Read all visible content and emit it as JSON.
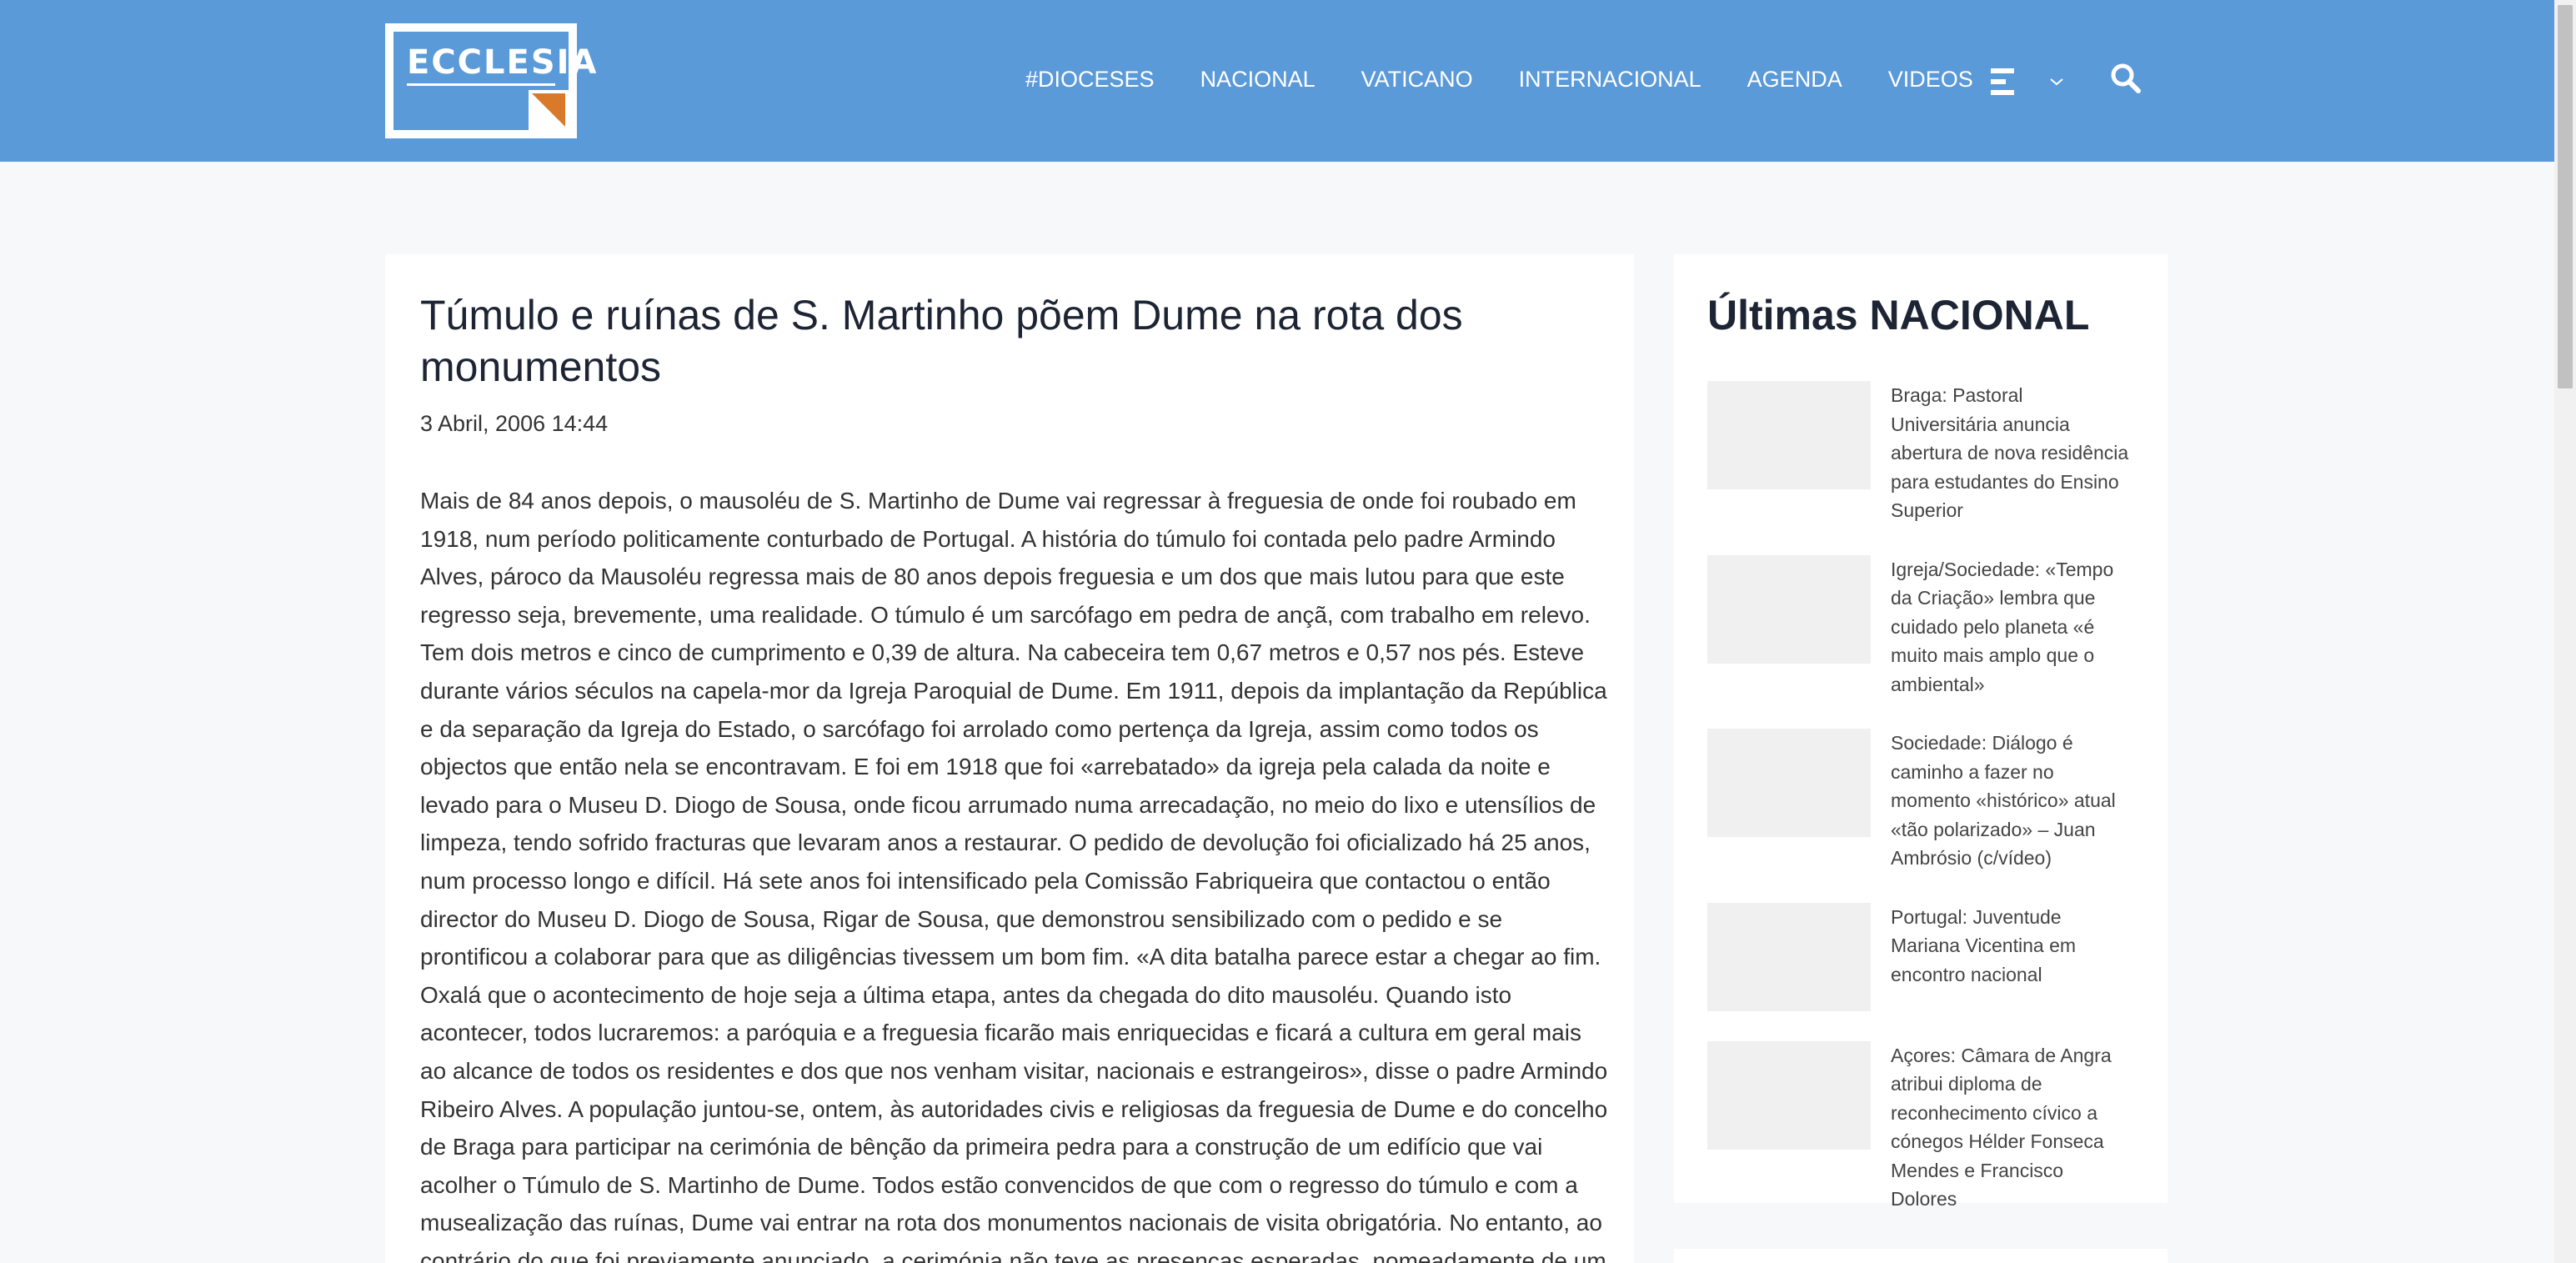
{
  "header": {
    "logo_text": "ECCLESIA",
    "nav": [
      "#DIOCESES",
      "NACIONAL",
      "VATICANO",
      "INTERNACIONAL",
      "AGENDA",
      "VIDEOS"
    ]
  },
  "article": {
    "title": "Túmulo e ruínas de S. Martinho põem Dume na rota dos monumentos",
    "date": "3 Abril, 2006 14:44",
    "body": "Mais de 84 anos depois, o mausoléu de S. Martinho de Dume vai regressar à freguesia de onde foi roubado em 1918, num período politicamente conturbado de Portugal. A história do túmulo foi contada pelo padre Armindo Alves, pároco da Mausoléu regressa mais de 80 anos depois freguesia e um dos que mais lutou para que este regresso seja, brevemente, uma realidade. O túmulo é um sarcófago em pedra de ançã, com trabalho em relevo. Tem dois metros e cinco de cumprimento e 0,39 de altura. Na cabeceira tem 0,67 metros e 0,57 nos pés. Esteve durante vários séculos na capela-mor da Igreja Paroquial de Dume. Em 1911, depois da implantação da República e da separação da Igreja do Estado, o sarcófago foi arrolado como pertença da Igreja, assim como todos os objectos que então nela se encontravam. E foi em 1918 que foi «arrebatado» da igreja pela calada da noite e levado para o Museu D. Diogo de Sousa, onde ficou arrumado numa arrecadação, no meio do lixo e utensílios de limpeza, tendo sofrido fracturas que levaram anos a restaurar. O pedido de devolução foi oficializado há 25 anos, num processo longo e difícil. Há sete anos foi intensificado pela Comissão Fabriqueira que contactou o então director do Museu D. Diogo de Sousa, Rigar de Sousa, que demonstrou sensibilizado com o pedido e se prontificou a colaborar para que as diligências tivessem um bom fim. «A dita batalha parece estar a chegar ao fim. Oxalá que o acontecimento de hoje seja a última etapa, antes da chegada do dito mausoléu. Quando isto acontecer, todos lucraremos: a paróquia e a freguesia ficarão mais enriquecidas e ficará a cultura em geral mais ao alcance de todos os residentes e dos que nos venham visitar, nacionais e estrangeiros», disse o padre Armindo Ribeiro Alves. A população juntou-se, ontem, às autoridades civis e religiosas da freguesia de Dume e do concelho de Braga para participar na cerimónia de bênção da primeira pedra para a construção de um edifício que vai acolher o Túmulo de S. Martinho de Dume. Todos estão convencidos de que com o regresso do túmulo e com a musealização das ruínas, Dume vai entrar na rota dos monumentos nacionais de visita obrigatória. No entanto, ao contrário do que foi previamente anunciado, a cerimónia não teve as presenças esperadas, nomeadamente de um representante do IPAAR, de Luís Fontes, da"
  },
  "sidebar": {
    "title": "Últimas NACIONAL",
    "items": [
      {
        "text": "Braga: Pastoral Universitária anuncia abertura de nova residência para estudantes do Ensino Superior"
      },
      {
        "text": "Igreja/Sociedade: «Tempo da Criação» lembra que cuidado pelo planeta «é muito mais amplo que o ambiental»"
      },
      {
        "text": "Sociedade: Diálogo é caminho a fazer no momento «histórico» atual «tão polarizado» – Juan Ambrósio (c/vídeo)"
      },
      {
        "text": "Portugal: Juventude Mariana Vicentina em encontro nacional"
      },
      {
        "text": "Açores: Câmara de Angra atribui diploma de reconhecimento cívico a cónegos Hélder Fonseca Mendes e Francisco Dolores"
      }
    ]
  },
  "colors": {
    "header_bg": "#5b9ad9",
    "logo_accent": "#d97a2b",
    "page_bg": "#f7f8fa"
  },
  "icons": [
    "menu-icon",
    "chevron-down-icon",
    "search-icon"
  ]
}
